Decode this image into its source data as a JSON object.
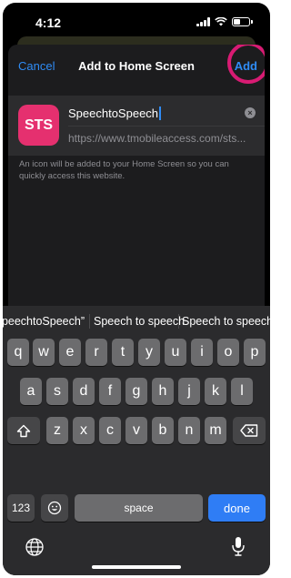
{
  "status": {
    "time": "4:12"
  },
  "nav": {
    "cancel": "Cancel",
    "title": "Add to Home Screen",
    "add": "Add"
  },
  "app": {
    "icon_text": "STS",
    "icon_color": "#e5306f",
    "name_value": "SpeechtoSpeech",
    "url": "https://www.tmobileaccess.com/sts...",
    "hint": "An icon will be added to your Home Screen so you can quickly access this website."
  },
  "keyboard": {
    "suggestions": [
      "“SpeechtoSpeech”",
      "Speech to speech",
      "Speech to speeches"
    ],
    "row1": [
      "q",
      "w",
      "e",
      "r",
      "t",
      "y",
      "u",
      "i",
      "o",
      "p"
    ],
    "row2": [
      "a",
      "s",
      "d",
      "f",
      "g",
      "h",
      "j",
      "k",
      "l"
    ],
    "row3": [
      "z",
      "x",
      "c",
      "v",
      "b",
      "n",
      "m"
    ],
    "numbers_key": "123",
    "space": "space",
    "done": "done",
    "accent_color": "#2f7df5"
  },
  "annotation": {
    "highlight_color": "#d81b73"
  }
}
